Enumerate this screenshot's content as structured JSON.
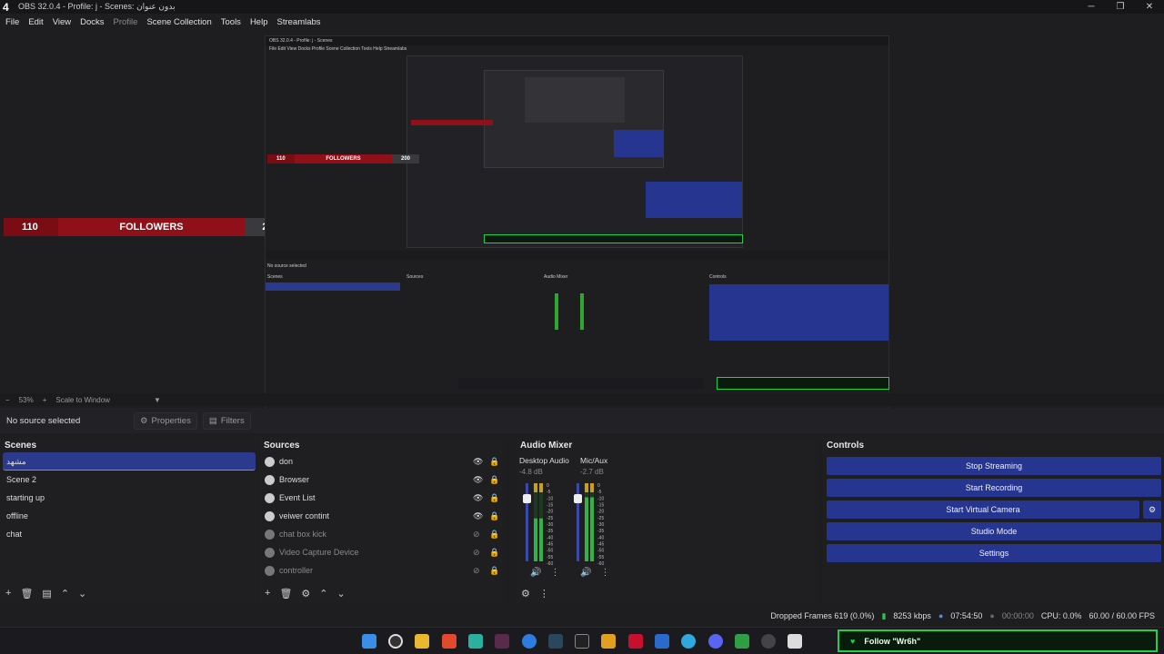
{
  "window": {
    "title": "OBS 32.0.4 - Profile: j - Scenes: بدون عنوان",
    "logo": "4"
  },
  "menu": [
    "File",
    "Edit",
    "View",
    "Docks",
    "Profile",
    "Scene Collection",
    "Tools",
    "Help",
    "Streamlabs"
  ],
  "overlay": {
    "left_value": "110",
    "label": "FOLLOWERS",
    "right_value": "200"
  },
  "zoom": {
    "level": "53%",
    "scale": "Scale to Window"
  },
  "context": {
    "no_source": "No source selected",
    "properties": "Properties",
    "filters": "Filters"
  },
  "scenes": {
    "title": "Scenes",
    "items": [
      "مشهد",
      "Scene 2",
      "starting up",
      "offline",
      "chat"
    ]
  },
  "sources": {
    "title": "Sources",
    "items": [
      {
        "name": "don",
        "enabled": true
      },
      {
        "name": "Browser",
        "enabled": true
      },
      {
        "name": "Event List",
        "enabled": true
      },
      {
        "name": "veiwer contint",
        "enabled": true
      },
      {
        "name": "chat box kick",
        "enabled": false
      },
      {
        "name": "Video Capture Device",
        "enabled": false
      },
      {
        "name": "controller",
        "enabled": false
      }
    ]
  },
  "mixer": {
    "title": "Audio Mixer",
    "channels": [
      {
        "name": "Desktop Audio",
        "db": "-4.8 dB",
        "level": 0.55
      },
      {
        "name": "Mic/Aux",
        "db": "-2.7 dB",
        "level": 0.82
      }
    ],
    "scale": [
      "0",
      "-5",
      "-10",
      "-15",
      "-20",
      "-25",
      "-30",
      "-35",
      "-40",
      "-45",
      "-50",
      "-55",
      "-60"
    ]
  },
  "controls": {
    "title": "Controls",
    "buttons": [
      "Stop Streaming",
      "Start Recording",
      "Start Virtual Camera",
      "Studio Mode",
      "Settings"
    ]
  },
  "status": {
    "dropped": "Dropped Frames 619 (0.0%)",
    "kbps": "8253 kbps",
    "stream_time": "07:54:50",
    "rec_time": "00:00:00",
    "cpu": "CPU: 0.0%",
    "fps": "60.00 / 60.00 FPS"
  },
  "follow_alert": "Follow \"Wr6h\"",
  "icons": [
    "obs-logo-icon",
    "eye-icon",
    "lock-icon",
    "gear-icon",
    "add-icon",
    "trash-icon",
    "filter-icon",
    "up-icon",
    "down-icon",
    "speaker-icon",
    "menu-dots-icon",
    "windows-start-icon"
  ],
  "colors": {
    "accent": "#26358f",
    "selected_scene": "#2b3a8c",
    "follower_red": "#8f1018",
    "follow_green": "#1fd14a"
  }
}
